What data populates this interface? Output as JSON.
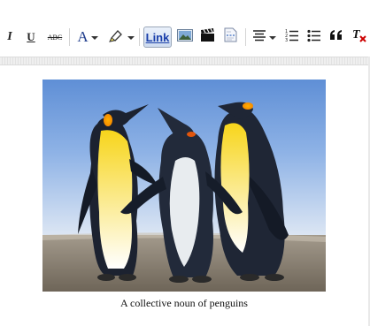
{
  "toolbar": {
    "italic_label": "I",
    "underline_label": "U",
    "strike_label": "ABC",
    "font_color_label": "A",
    "link_label": "Link"
  },
  "figure": {
    "caption": "A collective noun of penguins"
  },
  "colors": {
    "link_text": "#1a3faa",
    "remove_format_x": "#cc0000"
  }
}
